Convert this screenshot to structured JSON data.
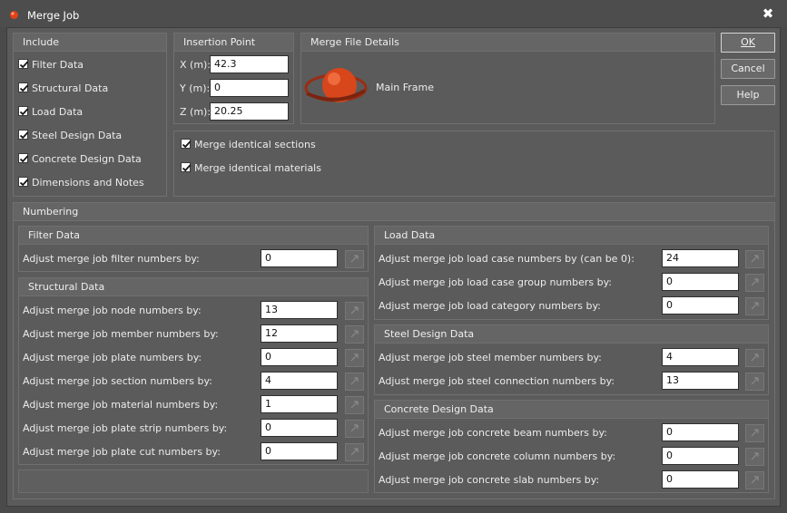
{
  "window": {
    "title": "Merge Job",
    "close_glyph": "✖"
  },
  "buttons": {
    "ok": "OK",
    "cancel": "Cancel",
    "help": "Help"
  },
  "include": {
    "title": "Include",
    "items": [
      {
        "label": "Filter Data",
        "checked": true
      },
      {
        "label": "Structural Data",
        "checked": true
      },
      {
        "label": "Load Data",
        "checked": true
      },
      {
        "label": "Steel Design Data",
        "checked": true
      },
      {
        "label": "Concrete Design Data",
        "checked": true
      },
      {
        "label": "Dimensions and Notes",
        "checked": true
      }
    ]
  },
  "insertion": {
    "title": "Insertion Point",
    "x_label": "X (m):",
    "x_value": "42.3",
    "y_label": "Y (m):",
    "y_value": "0",
    "z_label": "Z (m):",
    "z_value": "20.25"
  },
  "details": {
    "title": "Merge File Details",
    "file_name": "Main Frame"
  },
  "options": {
    "identical_sections": {
      "label": "Merge identical sections",
      "checked": true
    },
    "identical_materials": {
      "label": "Merge identical materials",
      "checked": true
    }
  },
  "numbering": {
    "title": "Numbering",
    "filter": {
      "title": "Filter Data",
      "rows": [
        {
          "label": "Adjust merge job filter numbers by:",
          "value": "0"
        }
      ]
    },
    "structural": {
      "title": "Structural Data",
      "rows": [
        {
          "label": "Adjust merge job node numbers by:",
          "value": "13"
        },
        {
          "label": "Adjust merge job member numbers by:",
          "value": "12"
        },
        {
          "label": "Adjust merge job plate numbers by:",
          "value": "0"
        },
        {
          "label": "Adjust merge job section numbers by:",
          "value": "4"
        },
        {
          "label": "Adjust merge job material numbers by:",
          "value": "1"
        },
        {
          "label": "Adjust merge job plate strip numbers by:",
          "value": "0"
        },
        {
          "label": "Adjust merge job plate cut numbers by:",
          "value": "0"
        }
      ]
    },
    "load": {
      "title": "Load Data",
      "rows": [
        {
          "label": "Adjust merge job load case numbers by (can be 0):",
          "value": "24"
        },
        {
          "label": "Adjust merge job load case group numbers by:",
          "value": "0"
        },
        {
          "label": "Adjust merge job load category numbers by:",
          "value": "0"
        }
      ]
    },
    "steel": {
      "title": "Steel Design Data",
      "rows": [
        {
          "label": "Adjust merge job steel member numbers by:",
          "value": "4"
        },
        {
          "label": "Adjust merge job steel connection numbers by:",
          "value": "13"
        }
      ]
    },
    "concrete": {
      "title": "Concrete Design Data",
      "rows": [
        {
          "label": "Adjust merge job concrete beam numbers by:",
          "value": "0"
        },
        {
          "label": "Adjust merge job concrete column numbers by:",
          "value": "0"
        },
        {
          "label": "Adjust merge job concrete slab numbers by:",
          "value": "0"
        }
      ]
    }
  }
}
